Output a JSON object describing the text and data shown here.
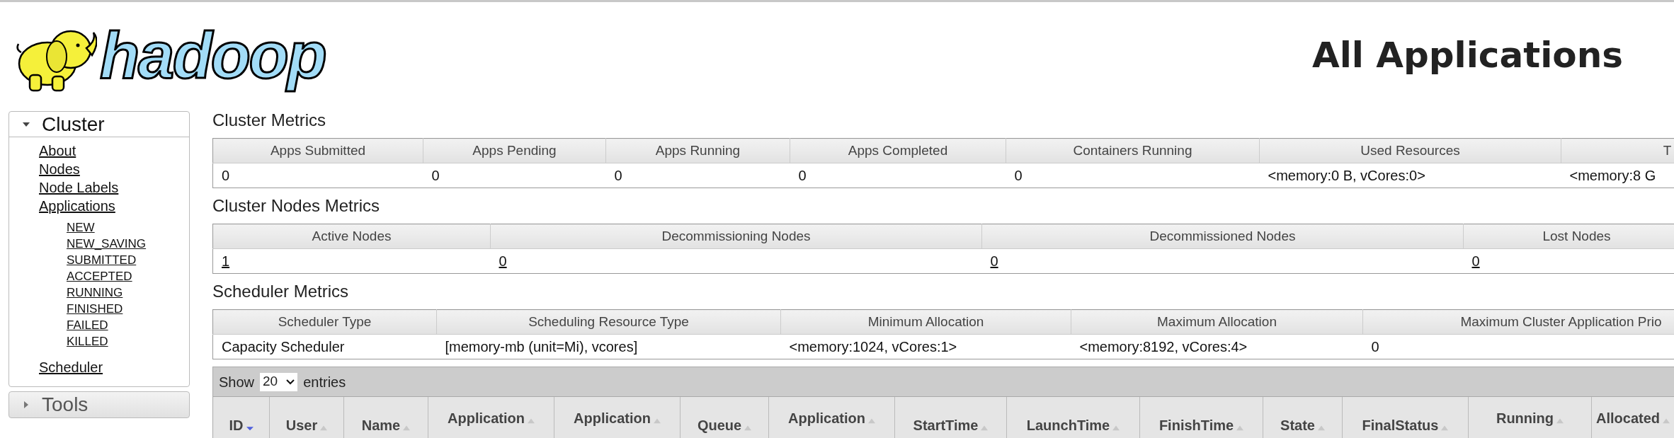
{
  "logo": {
    "text": "hadoop"
  },
  "page_title": "All Applications",
  "sidebar": [
    {
      "label": "Cluster",
      "expanded": true,
      "items": [
        {
          "label": "About"
        },
        {
          "label": "Nodes"
        },
        {
          "label": "Node Labels"
        },
        {
          "label": "Applications",
          "children": [
            {
              "label": "NEW"
            },
            {
              "label": "NEW_SAVING"
            },
            {
              "label": "SUBMITTED"
            },
            {
              "label": "ACCEPTED"
            },
            {
              "label": "RUNNING"
            },
            {
              "label": "FINISHED"
            },
            {
              "label": "FAILED"
            },
            {
              "label": "KILLED"
            }
          ]
        },
        {
          "label": "Scheduler"
        }
      ]
    },
    {
      "label": "Tools",
      "expanded": false
    }
  ],
  "metrics": [
    {
      "title": "Cluster Metrics",
      "linked": false,
      "columns": [
        "Apps Submitted",
        "Apps Pending",
        "Apps Running",
        "Apps Completed",
        "Containers Running",
        "Used Resources",
        "T"
      ],
      "values": [
        "0",
        "0",
        "0",
        "0",
        "0",
        "<memory:0 B, vCores:0>",
        "<memory:8 G"
      ]
    },
    {
      "title": "Cluster Nodes Metrics",
      "linked": true,
      "columns": [
        "Active Nodes",
        "Decommissioning Nodes",
        "Decommissioned Nodes",
        "Lost Nodes"
      ],
      "values": [
        "1",
        "0",
        "0",
        "0"
      ]
    },
    {
      "title": "Scheduler Metrics",
      "linked": false,
      "columns": [
        "Scheduler Type",
        "Scheduling Resource Type",
        "Minimum Allocation",
        "Maximum Allocation",
        "Maximum Cluster Application Prio"
      ],
      "values": [
        "Capacity Scheduler",
        "[memory-mb (unit=Mi), vcores]",
        "<memory:1024, vCores:1>",
        "<memory:8192, vCores:4>",
        "0"
      ]
    }
  ],
  "applications_table": {
    "show_label": "Show",
    "page_size": "20",
    "entries_label": "entries",
    "columns": [
      {
        "label": "ID",
        "sorted": true
      },
      {
        "label": "User",
        "sorted": false
      },
      {
        "label": "Name",
        "sorted": false
      },
      {
        "label": "Application",
        "sorted": false
      },
      {
        "label": "Application",
        "sorted": false
      },
      {
        "label": "Queue",
        "sorted": false
      },
      {
        "label": "Application",
        "sorted": false
      },
      {
        "label": "StartTime",
        "sorted": false
      },
      {
        "label": "LaunchTime",
        "sorted": false
      },
      {
        "label": "FinishTime",
        "sorted": false
      },
      {
        "label": "State",
        "sorted": false
      },
      {
        "label": "FinalStatus",
        "sorted": false
      },
      {
        "label": "Running",
        "sorted": false
      },
      {
        "label": "Allocated",
        "sorted": false
      }
    ]
  }
}
